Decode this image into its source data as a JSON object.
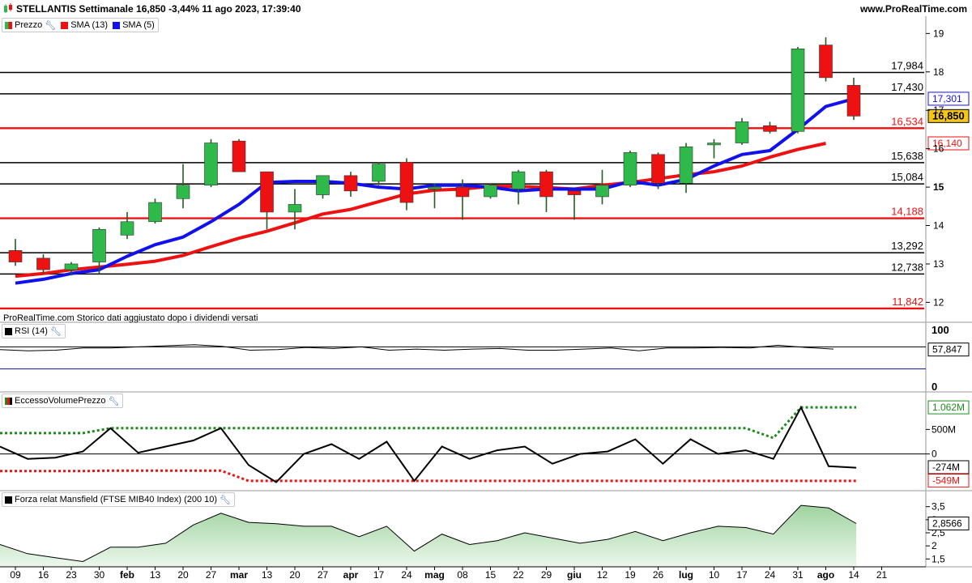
{
  "header": {
    "title": "STELLANTIS Settimanale 16,850 -3,44% 11 ago 2023, 17:39:40",
    "site": "www.ProRealTime.com"
  },
  "legends": {
    "price": "Prezzo",
    "sma13": "SMA (13)",
    "sma5": "SMA (5)",
    "rsi": "RSI (14)",
    "volume": "EccessoVolumePrezzo",
    "mansfield": "Forza relat Mansfield (FTSE MIB40 Index) (200 10)"
  },
  "footnote": "ProRealTime.com  Storico dati aggiustato dopo i dividendi versati",
  "icons": {
    "wrench": "wrench-icon",
    "chart": "candle-chart-icon"
  },
  "colors": {
    "bull": "#2eb94a",
    "bear": "#ee1111",
    "sma13": "#ee1111",
    "sma5": "#1111ee",
    "vol_upper": "#1e8a1e",
    "vol_lower": "#ee1111",
    "mansfield_fill": "#bfe0bf"
  },
  "chart_data": [
    {
      "type": "candlestick",
      "title": "STELLANTIS Settimanale",
      "x_labels": [
        "09",
        "16",
        "23",
        "30",
        "feb",
        "13",
        "20",
        "27",
        "mar",
        "13",
        "20",
        "27",
        "apr",
        "17",
        "24",
        "mag",
        "08",
        "15",
        "22",
        "29",
        "giu",
        "12",
        "19",
        "26",
        "lug",
        "10",
        "17",
        "24",
        "31",
        "ago",
        "14",
        "21"
      ],
      "candles": [
        {
          "o": 13.35,
          "h": 13.65,
          "l": 12.95,
          "c": 13.05
        },
        {
          "o": 13.15,
          "h": 13.25,
          "l": 12.75,
          "c": 12.85
        },
        {
          "o": 12.85,
          "h": 13.05,
          "l": 12.7,
          "c": 13.0
        },
        {
          "o": 13.05,
          "h": 13.95,
          "l": 12.75,
          "c": 13.9
        },
        {
          "o": 13.75,
          "h": 14.35,
          "l": 13.65,
          "c": 14.1
        },
        {
          "o": 14.1,
          "h": 14.7,
          "l": 14.05,
          "c": 14.6
        },
        {
          "o": 14.7,
          "h": 15.6,
          "l": 14.45,
          "c": 15.05
        },
        {
          "o": 15.05,
          "h": 16.25,
          "l": 15.0,
          "c": 16.15
        },
        {
          "o": 16.2,
          "h": 16.25,
          "l": 15.4,
          "c": 15.4
        },
        {
          "o": 15.4,
          "h": 15.4,
          "l": 13.9,
          "c": 14.35
        },
        {
          "o": 14.35,
          "h": 14.95,
          "l": 13.9,
          "c": 14.55
        },
        {
          "o": 14.8,
          "h": 15.3,
          "l": 14.7,
          "c": 15.3
        },
        {
          "o": 15.3,
          "h": 15.4,
          "l": 14.75,
          "c": 14.9
        },
        {
          "o": 15.15,
          "h": 15.65,
          "l": 15.05,
          "c": 15.6
        },
        {
          "o": 15.65,
          "h": 15.75,
          "l": 14.4,
          "c": 14.6
        },
        {
          "o": 14.95,
          "h": 15.1,
          "l": 14.45,
          "c": 15.0
        },
        {
          "o": 15.0,
          "h": 15.2,
          "l": 14.15,
          "c": 14.75
        },
        {
          "o": 14.75,
          "h": 15.1,
          "l": 14.7,
          "c": 15.05
        },
        {
          "o": 14.95,
          "h": 15.45,
          "l": 14.55,
          "c": 15.4
        },
        {
          "o": 15.4,
          "h": 15.45,
          "l": 14.35,
          "c": 14.75
        },
        {
          "o": 14.9,
          "h": 14.9,
          "l": 14.15,
          "c": 14.8
        },
        {
          "o": 14.75,
          "h": 15.45,
          "l": 14.55,
          "c": 15.05
        },
        {
          "o": 15.05,
          "h": 15.95,
          "l": 15.0,
          "c": 15.9
        },
        {
          "o": 15.85,
          "h": 15.9,
          "l": 14.95,
          "c": 15.1
        },
        {
          "o": 15.1,
          "h": 16.15,
          "l": 14.85,
          "c": 16.05
        },
        {
          "o": 16.1,
          "h": 16.25,
          "l": 15.75,
          "c": 16.15
        },
        {
          "o": 16.15,
          "h": 16.8,
          "l": 16.1,
          "c": 16.7
        },
        {
          "o": 16.6,
          "h": 16.7,
          "l": 16.4,
          "c": 16.45
        },
        {
          "o": 16.45,
          "h": 18.65,
          "l": 16.4,
          "c": 18.6
        },
        {
          "o": 18.7,
          "h": 18.9,
          "l": 17.75,
          "c": 17.85
        },
        {
          "o": 17.65,
          "h": 17.85,
          "l": 16.75,
          "c": 16.85
        }
      ],
      "sma13": [
        12.68,
        12.75,
        12.85,
        12.92,
        12.99,
        13.07,
        13.22,
        13.45,
        13.67,
        13.85,
        14.07,
        14.3,
        14.42,
        14.62,
        14.82,
        14.92,
        14.95,
        15.02,
        15.02,
        14.99,
        14.95,
        15.05,
        15.12,
        15.22,
        15.32,
        15.4,
        15.55,
        15.78,
        15.98,
        16.14
      ],
      "sma5": [
        12.5,
        12.6,
        12.75,
        12.85,
        13.2,
        13.5,
        13.7,
        14.1,
        14.55,
        15.12,
        15.15,
        15.15,
        15.1,
        15.0,
        14.95,
        15.05,
        15.05,
        15.0,
        14.9,
        14.95,
        14.95,
        14.95,
        15.15,
        15.05,
        15.2,
        15.55,
        15.85,
        15.95,
        16.5,
        17.1,
        17.3
      ],
      "ylim": [
        11.65,
        19.45
      ],
      "y_ticks": [
        "12",
        "13",
        "14",
        "15",
        "16",
        "17",
        "18",
        "19"
      ],
      "levels": [
        {
          "value": 17.984,
          "label": "17,984",
          "color": "#000000"
        },
        {
          "value": 17.43,
          "label": "17,430",
          "color": "#000000"
        },
        {
          "value": 16.534,
          "label": "16,534",
          "color": "#ee1111"
        },
        {
          "value": 15.638,
          "label": "15,638",
          "color": "#000000"
        },
        {
          "value": 15.084,
          "label": "15,084",
          "color": "#000000"
        },
        {
          "value": 14.188,
          "label": "14,188",
          "color": "#ee1111"
        },
        {
          "value": 13.292,
          "label": "13,292",
          "color": "#000000"
        },
        {
          "value": 12.738,
          "label": "12,738",
          "color": "#000000"
        },
        {
          "value": 11.842,
          "label": "11,842",
          "color": "#ee1111"
        }
      ],
      "value_tags": [
        {
          "label": "17,301",
          "value": 17.301,
          "color": "#1111ee"
        },
        {
          "label": "16,850",
          "value": 16.85,
          "color": "#000000",
          "fill": "#f5c518"
        },
        {
          "label": "16,140",
          "value": 16.14,
          "color": "#ee1111"
        }
      ]
    },
    {
      "type": "line",
      "title": "RSI (14)",
      "values": [
        65,
        63,
        64,
        68,
        68,
        70,
        72,
        74,
        71,
        64,
        65,
        69,
        67,
        70,
        64,
        66,
        64,
        66,
        67,
        64,
        64,
        66,
        68,
        63,
        68,
        68,
        69,
        68,
        73,
        69,
        66
      ],
      "ylim": [
        0,
        100
      ],
      "y_ticks": [
        "100",
        "0"
      ],
      "levels": [
        70,
        30
      ],
      "value_tags": [
        {
          "label": "57,847",
          "value": 57.847
        }
      ]
    },
    {
      "type": "line",
      "title": "EccessoVolumePrezzo",
      "values": [
        300,
        -200,
        -150,
        100,
        1050,
        50,
        300,
        550,
        1050,
        -450,
        -1150,
        0,
        400,
        -200,
        500,
        -1100,
        300,
        -200,
        150,
        300,
        -400,
        0,
        100,
        600,
        -400,
        600,
        0,
        150,
        -200,
        1900,
        -500,
        -560
      ],
      "upper_band": [
        850,
        850,
        850,
        850,
        1050,
        1050,
        1050,
        1050,
        1050,
        1050,
        1050,
        1050,
        1050,
        1050,
        1050,
        1050,
        1050,
        1050,
        1050,
        1050,
        1050,
        1050,
        1050,
        1050,
        1050,
        1050,
        1050,
        1050,
        650,
        1900,
        1900,
        1900
      ],
      "lower_band": [
        -700,
        -700,
        -700,
        -700,
        -680,
        -680,
        -680,
        -680,
        -680,
        -1100,
        -1100,
        -1100,
        -1100,
        -1100,
        -1100,
        -1100,
        -1100,
        -1100,
        -1100,
        -1100,
        -1100,
        -1100,
        -1100,
        -1100,
        -1100,
        -1100,
        -1100,
        -1100,
        -1100,
        -1100,
        -1100,
        -1100
      ],
      "ylim": [
        -1300,
        2200
      ],
      "y_ticks": [
        {
          "label": "500M",
          "value": 1000
        },
        {
          "label": "0",
          "value": 0
        }
      ],
      "value_tags": [
        {
          "label": "1.062M",
          "value": 1900,
          "color": "#1e8a1e"
        },
        {
          "label": "-274M",
          "value": -540,
          "color": "#000000"
        },
        {
          "label": "-549M",
          "value": -1090,
          "color": "#ee1111"
        }
      ]
    },
    {
      "type": "area",
      "title": "Forza relat Mansfield (FTSE MIB40 Index) (200 10)",
      "values": [
        2.05,
        1.7,
        1.55,
        1.4,
        1.95,
        1.95,
        2.1,
        2.8,
        3.25,
        2.9,
        2.85,
        2.75,
        2.75,
        2.35,
        2.75,
        1.8,
        2.45,
        2.05,
        2.2,
        2.5,
        2.3,
        2.1,
        2.25,
        2.55,
        2.2,
        2.5,
        2.75,
        2.7,
        2.45,
        3.55,
        3.45,
        2.8566
      ],
      "ylim": [
        1.2,
        3.8
      ],
      "y_ticks": [
        "3,5",
        "3",
        "2,5",
        "2",
        "1,5"
      ],
      "value_tags": [
        {
          "label": "2,8566",
          "value": 2.8566
        }
      ]
    }
  ]
}
